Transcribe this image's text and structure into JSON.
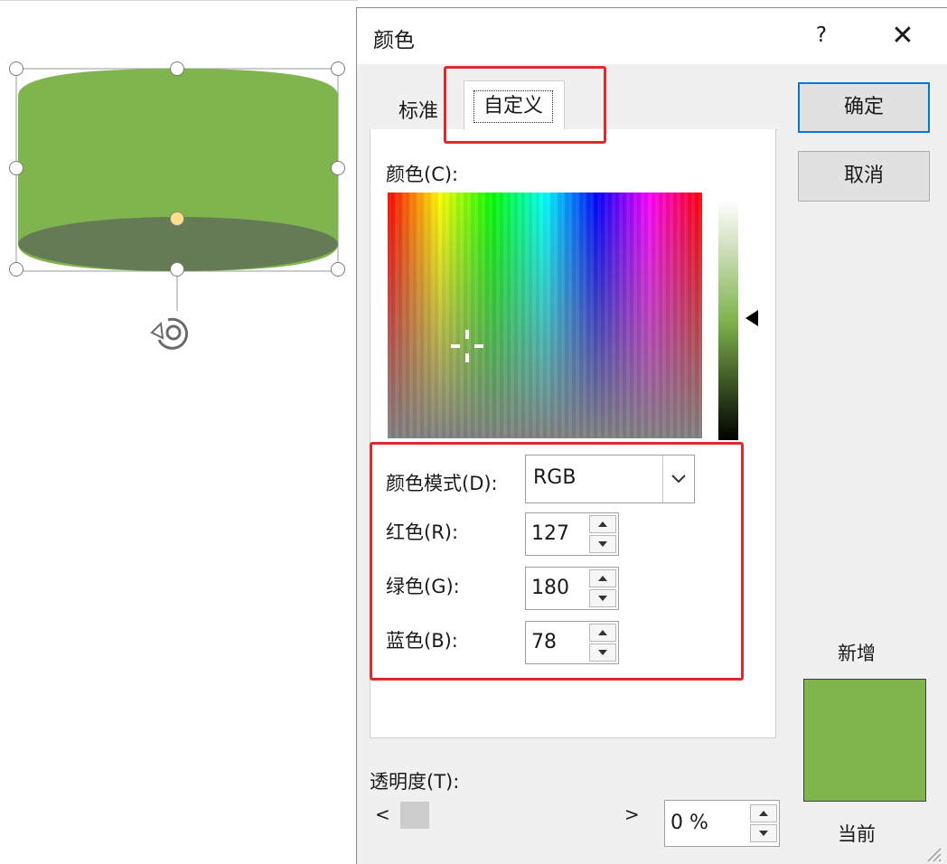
{
  "dialog": {
    "title": "颜色",
    "help_label": "?",
    "close_label": "✕",
    "tabs": [
      {
        "label": "标准",
        "active": false
      },
      {
        "label": "自定义",
        "active": true
      }
    ],
    "colors_label": "颜色(C):",
    "color_mode": {
      "label": "颜色模式(D):",
      "value": "RGB"
    },
    "red": {
      "label": "红色(R):",
      "value": "127"
    },
    "green": {
      "label": "绿色(G):",
      "value": "180"
    },
    "blue": {
      "label": "蓝色(B):",
      "value": "78"
    },
    "transparency": {
      "label": "透明度(T):",
      "value": "0 %",
      "scroll_left": "<",
      "scroll_right": ">"
    },
    "ok_label": "确定",
    "cancel_label": "取消",
    "new_label": "新增",
    "current_label": "当前",
    "new_color": "#7fb44e",
    "current_color": "#7fb44e"
  },
  "shape": {
    "type": "cylinder",
    "fill_color": "#7fb44e",
    "bottom_color": "#647b55"
  },
  "highlight_color": "#e02a2a"
}
